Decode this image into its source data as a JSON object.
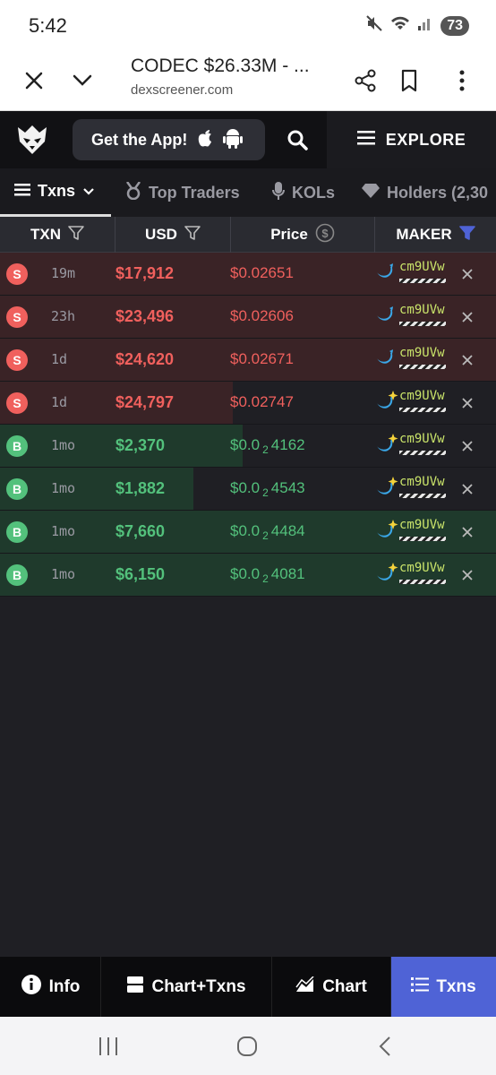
{
  "status_bar": {
    "time": "5:42",
    "battery": "73"
  },
  "browser": {
    "title": "CODEC $26.33M - ...",
    "url": "dexscreener.com",
    "icons": [
      "close-icon",
      "chevron-down-icon",
      "share-icon",
      "bookmark-icon",
      "more-vert-icon"
    ]
  },
  "header": {
    "get_app_label": "Get the App!",
    "explore_label": "EXPLORE"
  },
  "tabs": [
    {
      "label": "Txns",
      "active": true
    },
    {
      "label": "Top Traders",
      "active": false
    },
    {
      "label": "KOLs",
      "active": false
    },
    {
      "label": "Holders (2,30",
      "active": false
    }
  ],
  "columns": {
    "txn": "TXN",
    "usd": "USD",
    "price": "Price",
    "maker": "MAKER"
  },
  "rows": [
    {
      "type": "S",
      "age": "19m",
      "usd": "$17,912",
      "price": "$0.02651",
      "price_parts": null,
      "maker": "cm9UVw",
      "maker_icon": "whale-icon",
      "bar_fraction": 1.0
    },
    {
      "type": "S",
      "age": "23h",
      "usd": "$23,496",
      "price": "$0.02606",
      "price_parts": null,
      "maker": "cm9UVw",
      "maker_icon": "whale-icon",
      "bar_fraction": 1.0
    },
    {
      "type": "S",
      "age": "1d",
      "usd": "$24,620",
      "price": "$0.02671",
      "price_parts": null,
      "maker": "cm9UVw",
      "maker_icon": "whale-icon",
      "bar_fraction": 1.0
    },
    {
      "type": "S",
      "age": "1d",
      "usd": "$24,797",
      "price": "$0.02747",
      "price_parts": null,
      "maker": "cm9UVw",
      "maker_icon": "sparkle-whale-icon",
      "bar_fraction": 0.47
    },
    {
      "type": "B",
      "age": "1mo",
      "usd": "$2,370",
      "price": "$0.0",
      "price_sub": "2",
      "price_tail": "4162",
      "maker": "cm9UVw",
      "maker_icon": "sparkle-whale-icon",
      "bar_fraction": 0.49
    },
    {
      "type": "B",
      "age": "1mo",
      "usd": "$1,882",
      "price": "$0.0",
      "price_sub": "2",
      "price_tail": "4543",
      "maker": "cm9UVw",
      "maker_icon": "sparkle-whale-icon",
      "bar_fraction": 0.39
    },
    {
      "type": "B",
      "age": "1mo",
      "usd": "$7,660",
      "price": "$0.0",
      "price_sub": "2",
      "price_tail": "4484",
      "maker": "cm9UVw",
      "maker_icon": "sparkle-whale-icon",
      "bar_fraction": 1.0
    },
    {
      "type": "B",
      "age": "1mo",
      "usd": "$6,150",
      "price": "$0.0",
      "price_sub": "2",
      "price_tail": "4081",
      "maker": "cm9UVw",
      "maker_icon": "sparkle-whale-icon",
      "bar_fraction": 1.0
    }
  ],
  "bottom_nav": [
    {
      "label": "Info",
      "active": false
    },
    {
      "label": "Chart+Txns",
      "active": false
    },
    {
      "label": "Chart",
      "active": false
    },
    {
      "label": "Txns",
      "active": true
    }
  ],
  "colors": {
    "sell": "#f0605d",
    "buy": "#53c17c",
    "sell_bg": "#3a2326",
    "buy_bg": "#1f3a2c",
    "accent": "#4f63d6",
    "maker_text": "#c9e36a"
  }
}
